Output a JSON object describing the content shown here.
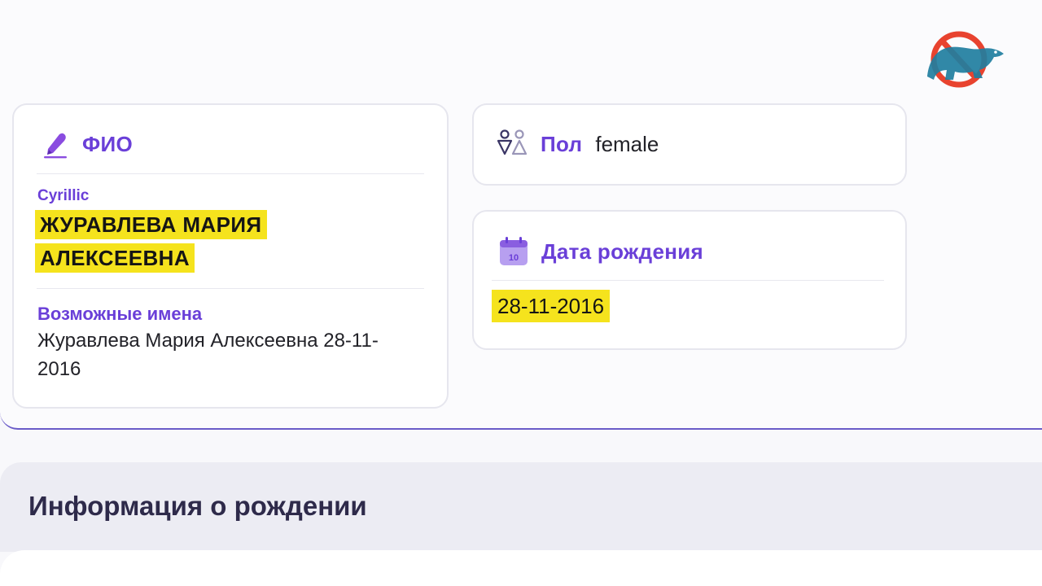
{
  "fio_card": {
    "title": "ФИО",
    "cyrillic_label": "Cyrillic",
    "name_line1": "ЖУРАВЛЕВА МАРИЯ",
    "name_line2": "АЛЕКСЕЕВНА",
    "possible_names_label": "Возможные имена",
    "possible_names_value": "Журавлева Мария Алексеевна 28-11-2016",
    "icon": "pen-icon"
  },
  "sex_card": {
    "title": "Пол",
    "value": "female",
    "icon": "gender-icon"
  },
  "dob_card": {
    "title": "Дата рождения",
    "value": "28-11-2016",
    "icon": "calendar-icon",
    "icon_day": "10"
  },
  "section": {
    "title": "Информация о рождении"
  },
  "colors": {
    "accent_purple": "#6a3fd8",
    "highlight_yellow": "#f5e31d",
    "logo_red": "#e8432f",
    "logo_teal": "#1f7ea0"
  }
}
